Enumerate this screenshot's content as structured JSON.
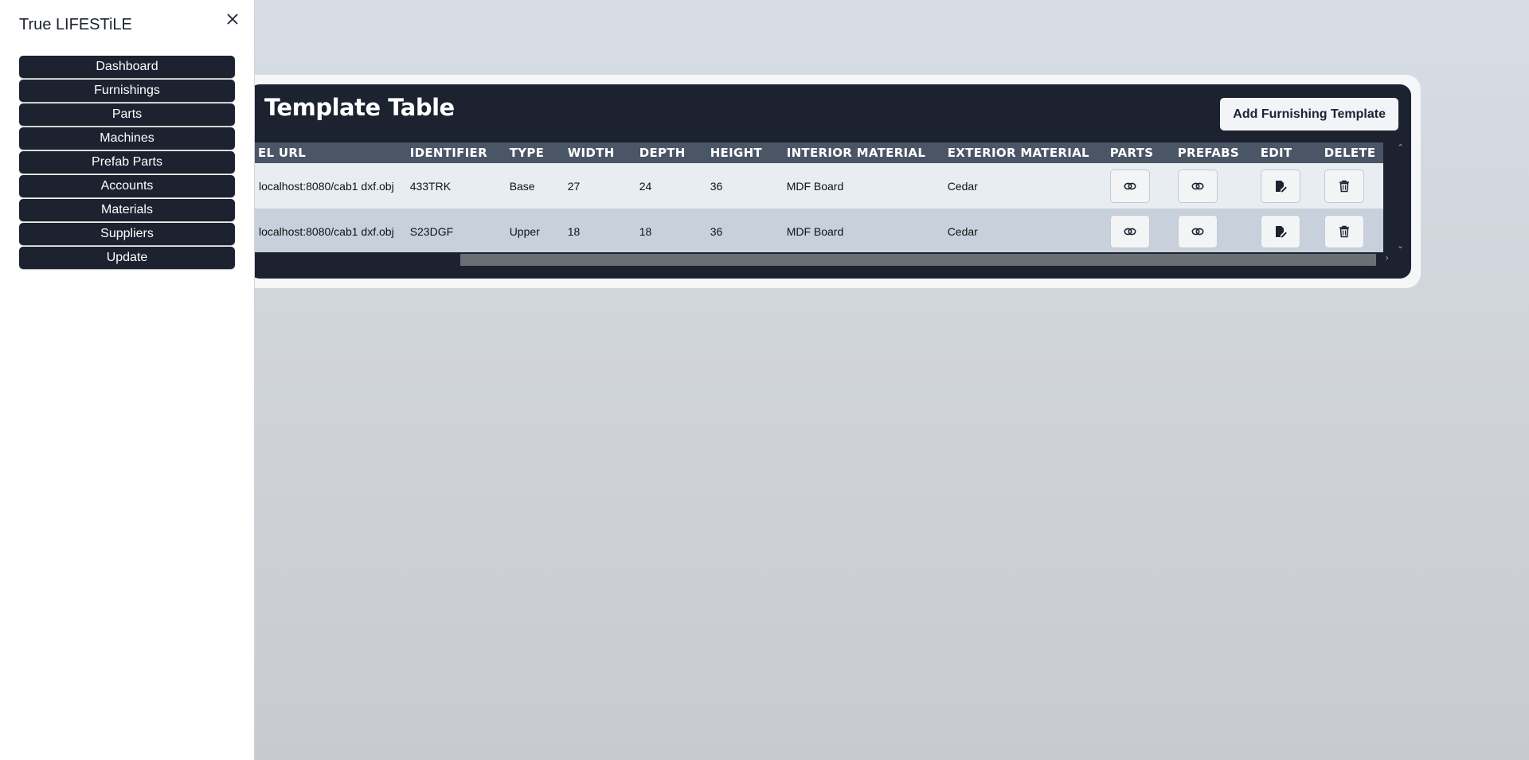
{
  "sidebar": {
    "brand": "True LIFESTiLE",
    "items": [
      {
        "label": "Dashboard"
      },
      {
        "label": "Furnishings"
      },
      {
        "label": "Parts"
      },
      {
        "label": "Machines"
      },
      {
        "label": "Prefab Parts"
      },
      {
        "label": "Accounts"
      },
      {
        "label": "Materials"
      },
      {
        "label": "Suppliers"
      },
      {
        "label": "Update"
      }
    ]
  },
  "main": {
    "title": "Template Table",
    "add_button": "Add Furnishing Template",
    "columns": [
      "EL URL",
      "IDENTIFIER",
      "TYPE",
      "WIDTH",
      "DEPTH",
      "HEIGHT",
      "INTERIOR MATERIAL",
      "EXTERIOR MATERIAL",
      "PARTS",
      "PREFABS",
      "EDIT",
      "DELETE"
    ],
    "rows": [
      {
        "url": "localhost:8080/cab1 dxf.obj",
        "identifier": "433TRK",
        "type": "Base",
        "width": "27",
        "depth": "24",
        "height": "36",
        "interior": "MDF Board",
        "exterior": "Cedar"
      },
      {
        "url": "localhost:8080/cab1 dxf.obj",
        "identifier": "S23DGF",
        "type": "Upper",
        "width": "18",
        "depth": "18",
        "height": "36",
        "interior": "MDF Board",
        "exterior": "Cedar"
      }
    ]
  },
  "icons": {
    "parts": "link-icon",
    "prefabs": "link-icon",
    "edit": "edit-document-icon",
    "delete": "trash-icon",
    "close": "close-icon"
  }
}
